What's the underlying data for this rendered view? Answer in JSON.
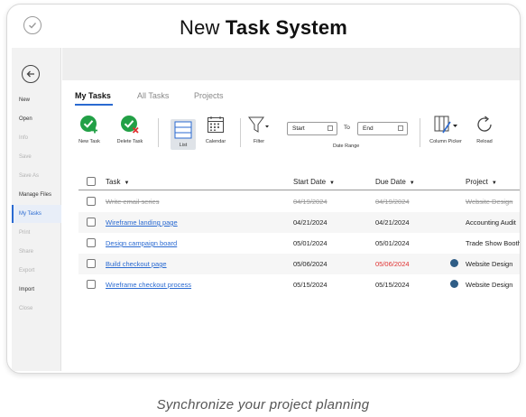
{
  "header": {
    "title_normal": "New",
    "title_bold": "Task System"
  },
  "sidebar": {
    "items": [
      {
        "label": "New",
        "state": "normal"
      },
      {
        "label": "Open",
        "state": "normal"
      },
      {
        "label": "Info",
        "state": "disabled"
      },
      {
        "label": "Save",
        "state": "disabled"
      },
      {
        "label": "Save As",
        "state": "disabled"
      },
      {
        "label": "Manage Files",
        "state": "normal"
      },
      {
        "label": "My Tasks",
        "state": "active"
      },
      {
        "label": "Print",
        "state": "disabled"
      },
      {
        "label": "Share",
        "state": "disabled"
      },
      {
        "label": "Export",
        "state": "disabled"
      },
      {
        "label": "Import",
        "state": "normal"
      },
      {
        "label": "Close",
        "state": "disabled"
      }
    ]
  },
  "tabs": [
    {
      "label": "My Tasks",
      "active": true
    },
    {
      "label": "All Tasks",
      "active": false
    },
    {
      "label": "Projects",
      "active": false
    }
  ],
  "toolbar": {
    "new_task": "New Task",
    "delete_task": "Delete Task",
    "list": "List",
    "calendar": "Calendar",
    "filter": "Filter",
    "start_value": "Start",
    "to_label": "To",
    "end_value": "End",
    "date_range": "Date Range",
    "column_picker": "Column Picker",
    "reload": "Reload"
  },
  "table": {
    "headers": {
      "task": "Task",
      "start": "Start Date",
      "due": "Due Date",
      "project": "Project"
    },
    "rows": [
      {
        "task": "Write email series",
        "start": "04/19/2024",
        "due": "04/19/2024",
        "project": "Website Design",
        "style": "done",
        "overdue": false,
        "avatar": false
      },
      {
        "task": "Wireframe landing page",
        "start": "04/21/2024",
        "due": "04/21/2024",
        "project": "Accounting Audit",
        "style": "link",
        "overdue": false,
        "avatar": false
      },
      {
        "task": "Design campaign board",
        "start": "05/01/2024",
        "due": "05/01/2024",
        "project": "Trade Show Booth",
        "style": "link",
        "overdue": false,
        "avatar": false
      },
      {
        "task": "Build checkout page",
        "start": "05/06/2024",
        "due": "05/06/2024",
        "project": "Website Design",
        "style": "link",
        "overdue": true,
        "avatar": true
      },
      {
        "task": "Wireframe checkout process",
        "start": "05/15/2024",
        "due": "05/15/2024",
        "project": "Website Design",
        "style": "link",
        "overdue": false,
        "avatar": true
      }
    ]
  },
  "colors": {
    "accent": "#2a6ad1",
    "green": "#22a046",
    "overdue": "#e03030"
  },
  "caption": "Synchronize  your project planning"
}
